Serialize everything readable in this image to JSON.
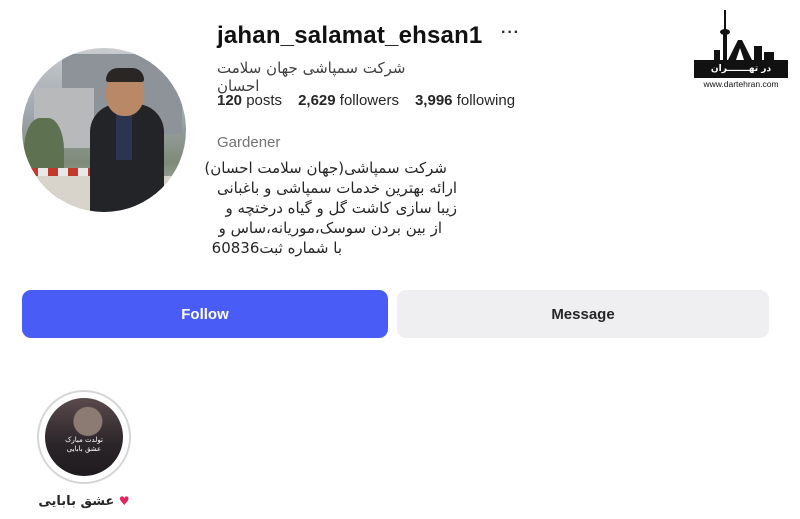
{
  "profile": {
    "username": "jahan_salamat_ehsan1",
    "more_glyph": "···",
    "full_name": "شرکت سمپاشی جهان سلامت احسان",
    "stats": {
      "posts_count": "120",
      "posts_label": "posts",
      "followers_count": "2,629",
      "followers_label": "followers",
      "following_count": "3,996",
      "following_label": "following"
    },
    "category": "Gardener",
    "bio_lines": [
      "شرکت سمپاشی(جهان سلامت احسان)",
      "ارائه بهترین خدمات سمپاشی و باغبانی",
      "زیبا سازی کاشت گل و گیاه درختچه و",
      "از بین بردن سوسک،موریانه،ساس و",
      "با شماره ثبت60836"
    ]
  },
  "actions": {
    "follow_label": "Follow",
    "message_label": "Message"
  },
  "highlights": [
    {
      "label": "عشق بابایی",
      "cover_text": "تولدت مبارک\nعشق بابایی",
      "icon": "heart-icon"
    }
  ],
  "watermark": {
    "logo_text": "در تهـــــــران",
    "url": "www.dartehran.com"
  },
  "colors": {
    "follow_button": "#4a5cf6",
    "message_button": "#efeff1",
    "heart": "#e0245e"
  }
}
